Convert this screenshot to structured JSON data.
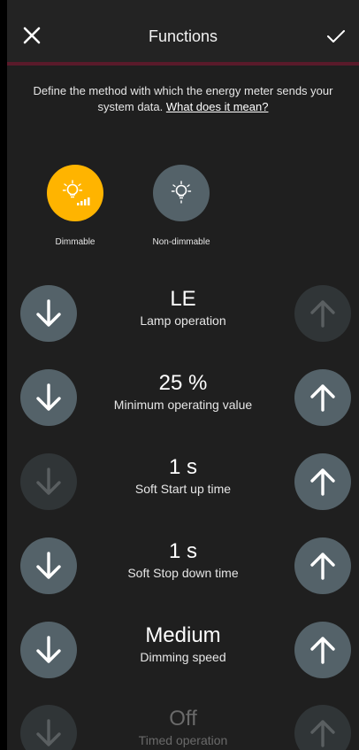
{
  "header": {
    "title": "Functions"
  },
  "description": {
    "text": "Define the method with which the energy meter sends your system data. ",
    "link": "What does it mean?"
  },
  "modes": [
    {
      "label": "Dimmable",
      "selected": true,
      "icon": "lamp-dimmable-icon"
    },
    {
      "label": "Non-dimmable",
      "selected": false,
      "icon": "lamp-icon"
    }
  ],
  "colors": {
    "accent": "#ffb400",
    "button": "#546269",
    "button_disabled": "#303537",
    "background": "#1f1f1f",
    "header_border": "#5a1a2a"
  },
  "parameters": [
    {
      "value": "LE",
      "name": "Lamp operation",
      "down_enabled": true,
      "up_enabled": false
    },
    {
      "value": "25 %",
      "name": "Minimum operating value",
      "down_enabled": true,
      "up_enabled": true
    },
    {
      "value": "1 s",
      "name": "Soft Start up time",
      "down_enabled": false,
      "up_enabled": true
    },
    {
      "value": "1 s",
      "name": "Soft Stop down time",
      "down_enabled": true,
      "up_enabled": true
    },
    {
      "value": "Medium",
      "name": "Dimming speed",
      "down_enabled": true,
      "up_enabled": true
    },
    {
      "value": "Off",
      "name": "Timed operation",
      "down_enabled": false,
      "up_enabled": false
    }
  ]
}
